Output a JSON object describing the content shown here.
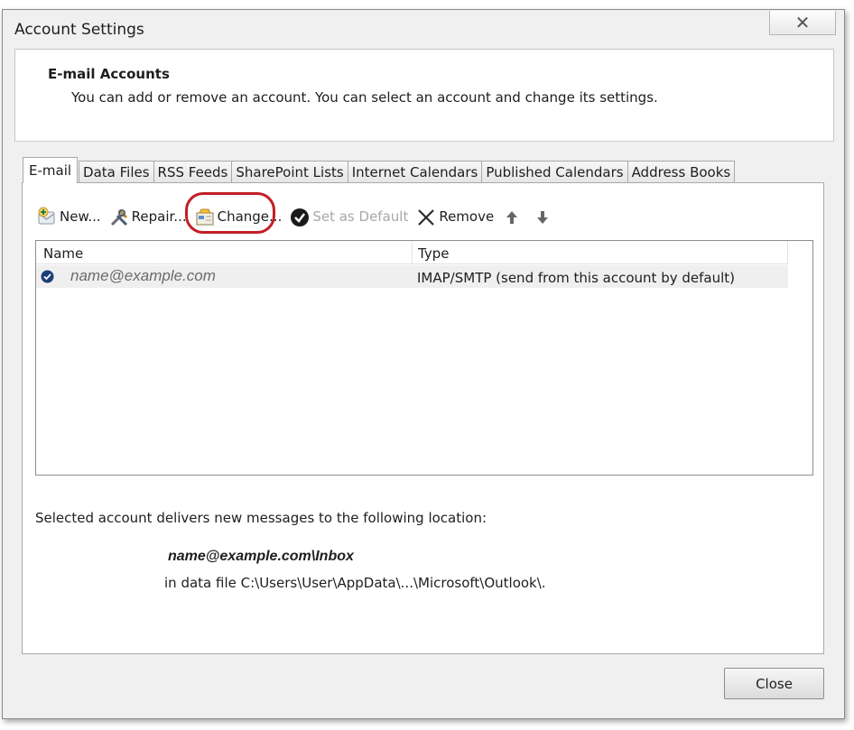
{
  "window": {
    "title": "Account Settings",
    "close_glyph": "✕"
  },
  "header": {
    "title": "E-mail Accounts",
    "description": "You can add or remove an account. You can select an account and change its settings."
  },
  "tabs": [
    {
      "label": "E-mail",
      "active": true
    },
    {
      "label": "Data Files"
    },
    {
      "label": "RSS Feeds"
    },
    {
      "label": "SharePoint Lists"
    },
    {
      "label": "Internet Calendars"
    },
    {
      "label": "Published Calendars"
    },
    {
      "label": "Address Books"
    }
  ],
  "toolbar": {
    "new_label": "New...",
    "repair_label": "Repair...",
    "change_label": "Change...",
    "set_default_label": "Set as Default",
    "remove_label": "Remove",
    "icons": [
      "new-account-icon",
      "repair-tools-icon",
      "change-settings-icon",
      "default-check-icon",
      "remove-x-icon",
      "move-up-icon",
      "move-down-icon"
    ],
    "highlight_color": "#c21e26"
  },
  "list": {
    "columns": [
      "Name",
      "Type"
    ],
    "rows": [
      {
        "name": "name@example.com",
        "type": "IMAP/SMTP (send from this account by default)",
        "default": true
      }
    ]
  },
  "location": {
    "text": "Selected account delivers new messages to the following location:",
    "path": "name@example.com\\Inbox",
    "file": "in data file C:\\Users\\User\\AppData\\...\\Microsoft\\Outlook\\."
  },
  "footer": {
    "close_label": "Close"
  }
}
